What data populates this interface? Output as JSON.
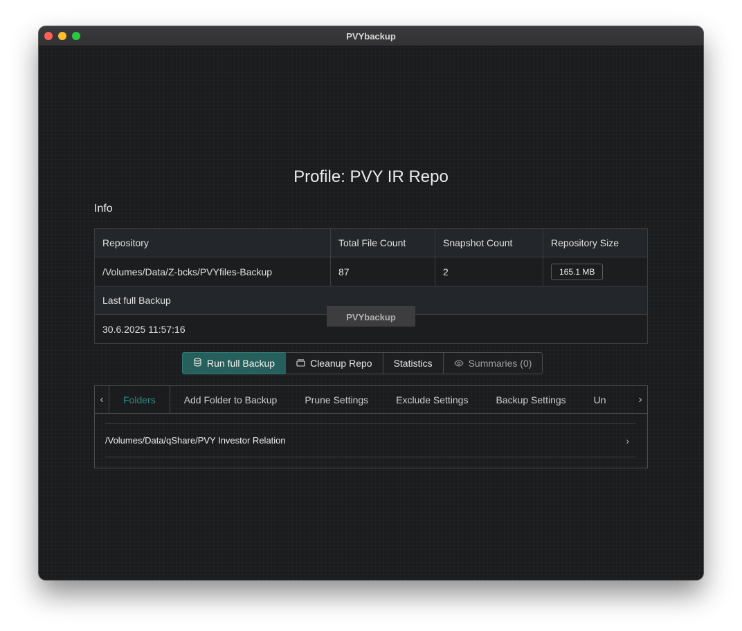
{
  "window": {
    "title": "PVYbackup"
  },
  "profile": {
    "title": "Profile: PVY IR Repo"
  },
  "info": {
    "heading": "Info",
    "headers": {
      "repository": "Repository",
      "total_file_count": "Total File Count",
      "snapshot_count": "Snapshot Count",
      "repository_size": "Repository Size"
    },
    "values": {
      "repository": "/Volumes/Data/Z-bcks/PVYfiles-Backup",
      "total_file_count": "87",
      "snapshot_count": "2",
      "repository_size": "165.1 MB"
    },
    "last_backup_label": "Last full Backup",
    "last_backup_value": "30.6.2025 11:57:16"
  },
  "toast": {
    "text": "PVYbackup"
  },
  "actions": {
    "run_full_backup": "Run full Backup",
    "cleanup_repo": "Cleanup Repo",
    "statistics": "Statistics",
    "summaries": "Summaries (0)"
  },
  "tabs": {
    "items": [
      "Folders",
      "Add Folder to Backup",
      "Prune Settings",
      "Exclude Settings",
      "Backup Settings",
      "Un"
    ],
    "active": "Folders"
  },
  "folders": [
    {
      "path": "/Volumes/Data/qShare/PVY Investor Relation"
    }
  ],
  "colors": {
    "accent": "#265f5c",
    "active_tab": "#2e8a84",
    "background": "#1b1c1d"
  }
}
